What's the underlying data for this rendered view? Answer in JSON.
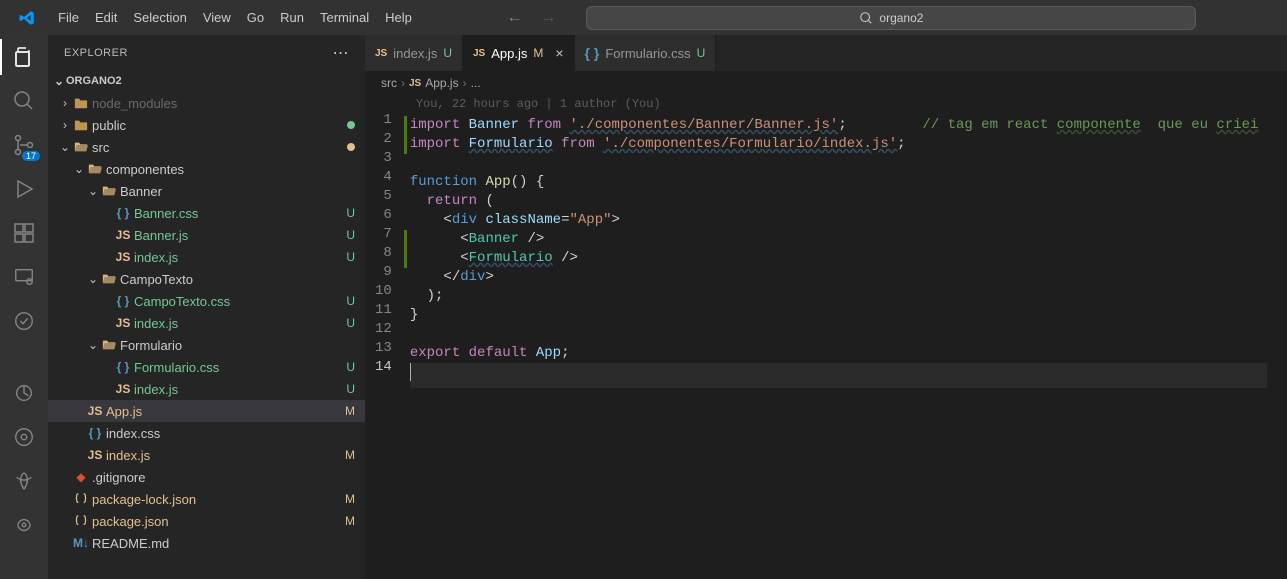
{
  "titlebar": {
    "menu": [
      "File",
      "Edit",
      "Selection",
      "View",
      "Go",
      "Run",
      "Terminal",
      "Help"
    ],
    "search_text": "organo2"
  },
  "activitybar": {
    "scm_badge": "17"
  },
  "sidebar": {
    "title": "EXPLORER",
    "section": "ORGANO2",
    "tree": [
      {
        "d": 1,
        "tw": ">",
        "ic": "folder",
        "label": "node_modules",
        "cls": "node-mod"
      },
      {
        "d": 1,
        "tw": ">",
        "ic": "folder",
        "label": "public",
        "status": "dot",
        "scls": "git-U"
      },
      {
        "d": 1,
        "tw": "v",
        "ic": "folder-open",
        "label": "src",
        "status": "dot",
        "scls": "git-M"
      },
      {
        "d": 2,
        "tw": "v",
        "ic": "folder-open",
        "label": "componentes"
      },
      {
        "d": 3,
        "tw": "v",
        "ic": "folder-open",
        "label": "Banner"
      },
      {
        "d": 4,
        "ic": "css",
        "label": "Banner.css",
        "status": "U",
        "scls": "git-U"
      },
      {
        "d": 4,
        "ic": "js",
        "label": "Banner.js",
        "status": "U",
        "scls": "git-U"
      },
      {
        "d": 4,
        "ic": "js",
        "label": "index.js",
        "status": "U",
        "scls": "git-U"
      },
      {
        "d": 3,
        "tw": "v",
        "ic": "folder-open",
        "label": "CampoTexto"
      },
      {
        "d": 4,
        "ic": "css",
        "label": "CampoTexto.css",
        "status": "U",
        "scls": "git-U"
      },
      {
        "d": 4,
        "ic": "js",
        "label": "index.js",
        "status": "U",
        "scls": "git-U"
      },
      {
        "d": 3,
        "tw": "v",
        "ic": "folder-open",
        "label": "Formulario"
      },
      {
        "d": 4,
        "ic": "css",
        "label": "Formulario.css",
        "status": "U",
        "scls": "git-U"
      },
      {
        "d": 4,
        "ic": "js",
        "label": "index.js",
        "status": "U",
        "scls": "git-U"
      },
      {
        "d": 2,
        "ic": "js",
        "label": "App.js",
        "status": "M",
        "scls": "git-M",
        "sel": true
      },
      {
        "d": 2,
        "ic": "css",
        "label": "index.css"
      },
      {
        "d": 2,
        "ic": "js",
        "label": "index.js",
        "status": "M",
        "scls": "git-M"
      },
      {
        "d": 1,
        "ic": "git",
        "label": ".gitignore"
      },
      {
        "d": 1,
        "ic": "json",
        "label": "package-lock.json",
        "status": "M",
        "scls": "git-M"
      },
      {
        "d": 1,
        "ic": "json",
        "label": "package.json",
        "status": "M",
        "scls": "git-M"
      },
      {
        "d": 1,
        "ic": "md",
        "label": "README.md"
      }
    ]
  },
  "tabs": [
    {
      "ic": "js",
      "label": "index.js",
      "status": "U",
      "scls": "git-U",
      "active": false,
      "close": false
    },
    {
      "ic": "js",
      "label": "App.js",
      "status": "M",
      "scls": "git-M",
      "active": true,
      "close": true
    },
    {
      "ic": "css",
      "label": "Formulario.css",
      "status": "U",
      "scls": "git-U",
      "active": false,
      "close": false
    }
  ],
  "breadcrumbs": {
    "a": "src",
    "b": "App.js",
    "c": "..."
  },
  "gitlens": "You, 22 hours ago | 1 author (You)",
  "code_lines": [
    {
      "n": 1,
      "bar": true,
      "html": "<span class='k-import'>import</span> <span class='k-ident'>Banner</span> <span class='k-from'>from</span> <span class='k-string k-underline'>'./componentes/Banner/Banner.js'</span><span class='k-white'>;</span>         <span class='k-comment'>// tag em react <span style='text-decoration:underline wavy #6a995566'>componente</span>  que eu <span style='text-decoration:underline wavy #6a995566'>criei</span></span>"
    },
    {
      "n": 2,
      "bar": true,
      "html": "<span class='k-import'>import</span> <span class='k-ident k-underline'>Formulario</span> <span class='k-from'>from</span> <span class='k-string k-underline'>'./componentes/Formulario/index.js'</span><span class='k-white'>;</span>"
    },
    {
      "n": 3,
      "html": ""
    },
    {
      "n": 4,
      "html": "<span class='k-fn'>function</span> <span class='k-func'>App</span><span class='k-white'>() {</span>"
    },
    {
      "n": 5,
      "html": "  <span class='k-keyword'>return</span> <span class='k-white'>(</span>"
    },
    {
      "n": 6,
      "html": "    <span class='k-white'>&lt;</span><span class='k-fn'>div</span> <span class='k-attr'>className</span><span class='k-white'>=</span><span class='k-string'>\"App\"</span><span class='k-white'>&gt;</span>"
    },
    {
      "n": 7,
      "bar": true,
      "html": "      <span class='k-white'>&lt;</span><span class='k-tag'>Banner</span> <span class='k-white'>/&gt;</span>"
    },
    {
      "n": 8,
      "bar": true,
      "html": "      <span class='k-white'>&lt;</span><span class='k-tag k-underline'>Formulario</span> <span class='k-white'>/&gt;</span>"
    },
    {
      "n": 9,
      "html": "    <span class='k-white'>&lt;/</span><span class='k-fn'>div</span><span class='k-white'>&gt;</span>"
    },
    {
      "n": 10,
      "html": "  <span class='k-white'>);</span>"
    },
    {
      "n": 11,
      "html": "<span class='k-white'>}</span>"
    },
    {
      "n": 12,
      "html": ""
    },
    {
      "n": 13,
      "html": "<span class='k-keyword'>export</span> <span class='k-keyword'>default</span> <span class='k-ident'>App</span><span class='k-white'>;</span>"
    },
    {
      "n": 14,
      "html": "<span class='cursor-line'></span>",
      "hl": true
    }
  ]
}
